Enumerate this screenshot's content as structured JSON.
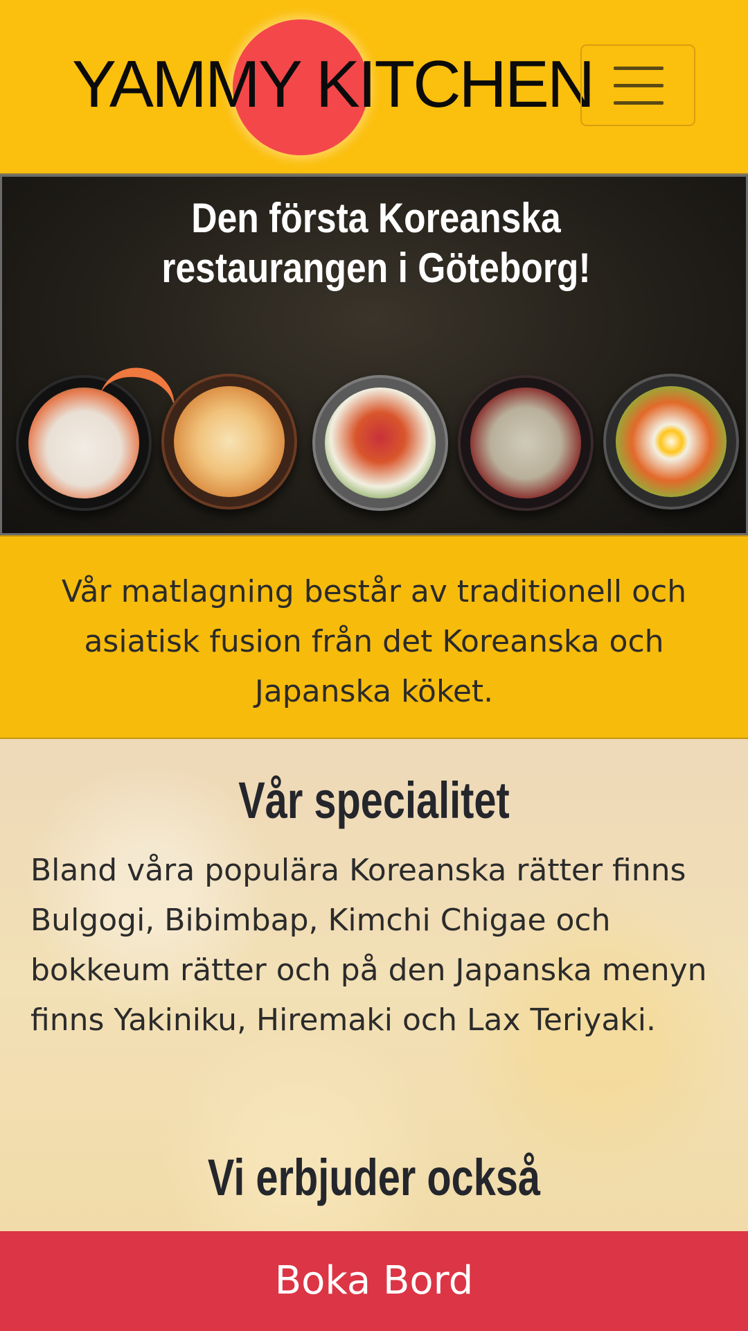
{
  "brand": {
    "name": "YAMMY KITCHEN"
  },
  "navbar": {
    "menu_icon": "hamburger-menu-icon"
  },
  "hero": {
    "title": "Den första Koreanska restaurangen i Göteborg!",
    "dishes": [
      "seafood-noodle-dish",
      "kimchi-dish",
      "hotpot-dish",
      "soup-dish",
      "bibimbap-dish"
    ]
  },
  "intro": {
    "text": "Vår matlagning består av traditionell och asiatisk fusion från det Koreanska och Japanska köket."
  },
  "specialty": {
    "heading": "Vår specialitet",
    "text": "Bland våra populära Koreanska rätter finns Bulgogi, Bibimbap, Kimchi Chigae och bokkeum rätter och på den Japanska menyn finns Yakiniku, Hiremaki och Lax Teriyaki.",
    "offer_heading": "Vi erbjuder också"
  },
  "cta": {
    "label": "Boka Bord"
  },
  "colors": {
    "header_bg": "#fbbf0d",
    "logo_sun": "#f4474a",
    "intro_bg": "#f7bb0c",
    "cta_bg": "#dc3545"
  }
}
